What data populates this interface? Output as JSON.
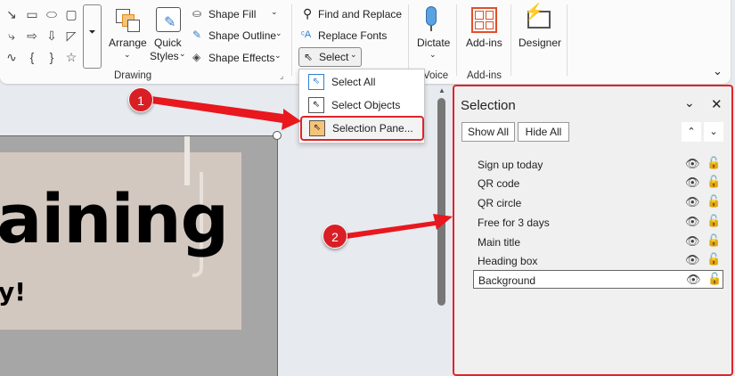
{
  "ribbon": {
    "drawing": {
      "arrange": "Arrange",
      "quick_styles_1": "Quick",
      "quick_styles_2": "Styles",
      "shape_fill": "Shape Fill",
      "shape_outline": "Shape Outline",
      "shape_effects": "Shape Effects",
      "group_label": "Drawing"
    },
    "editing": {
      "find_replace": "Find and Replace",
      "replace_fonts": "Replace Fonts",
      "select": "Select"
    },
    "voice": {
      "dictate": "Dictate",
      "group_label": "Voice"
    },
    "addins": {
      "addins": "Add-ins",
      "group_label": "Add-ins"
    },
    "designer": {
      "label": "Designer"
    }
  },
  "select_menu": {
    "items": [
      {
        "label": "Select All"
      },
      {
        "label": "Select Objects"
      },
      {
        "label": "Selection Pane..."
      }
    ]
  },
  "slide": {
    "title_fragment": "aining",
    "subtitle_fragment": "y!"
  },
  "selection_pane": {
    "title": "Selection",
    "show_all": "Show All",
    "hide_all": "Hide All",
    "items": [
      "Sign up today",
      "QR code",
      "QR circle",
      "Free for 3 days",
      "Main title",
      "Heading box",
      "Background"
    ]
  },
  "annotations": {
    "step1": "1",
    "step2": "2"
  },
  "colors": {
    "accent_red": "#e0242a"
  }
}
